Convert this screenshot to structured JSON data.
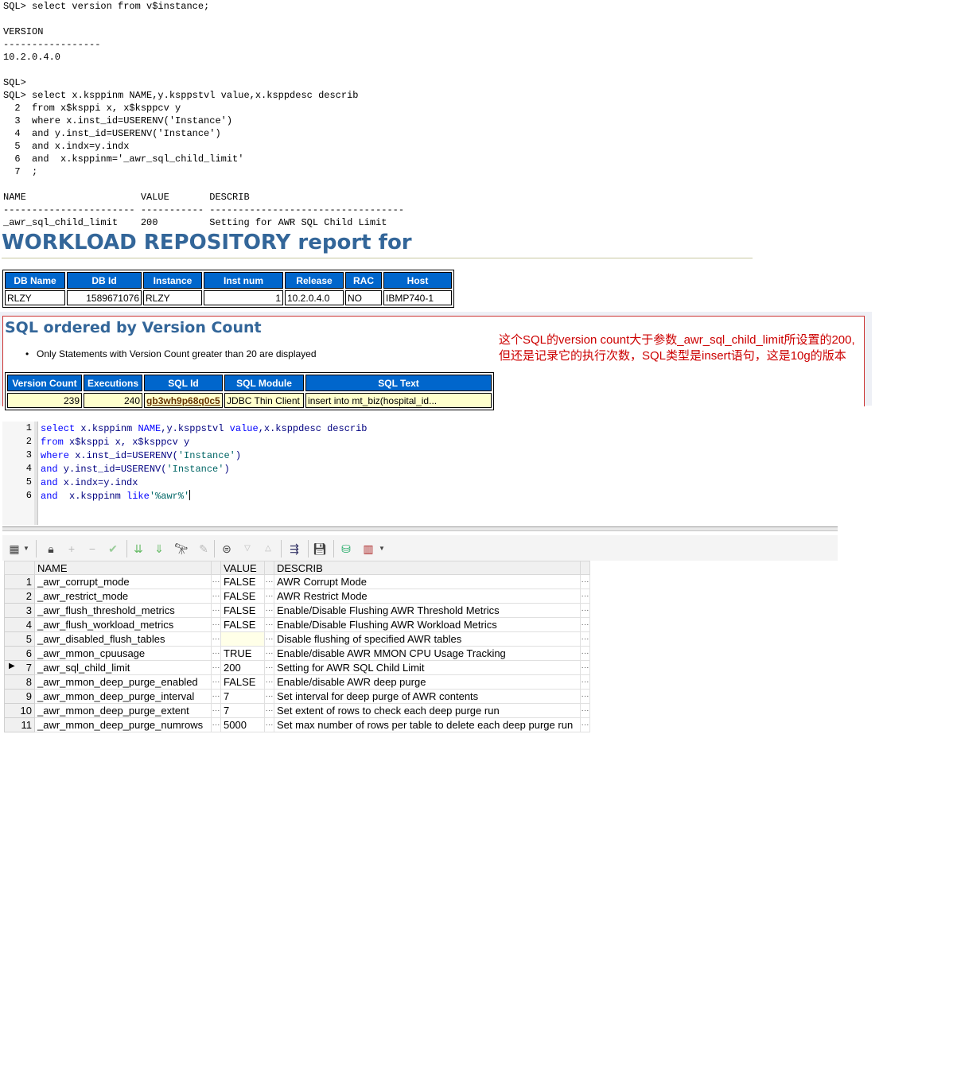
{
  "console": {
    "lines": [
      "SQL> select version from v$instance;",
      "",
      "VERSION",
      "-----------------",
      "10.2.0.4.0",
      "",
      "SQL>",
      "SQL> select x.ksppinm NAME,y.ksppstvl value,x.ksppdesc describ",
      "  2  from x$ksppi x, x$ksppcv y",
      "  3  where x.inst_id=USERENV('Instance')",
      "  4  and y.inst_id=USERENV('Instance')",
      "  5  and x.indx=y.indx",
      "  6  and  x.ksppinm='_awr_sql_child_limit'",
      "  7  ;",
      "",
      "NAME                    VALUE       DESCRIB",
      "----------------------- ----------- ----------------------------------",
      "_awr_sql_child_limit    200         Setting for AWR SQL Child Limit"
    ]
  },
  "awr": {
    "title": "WORKLOAD REPOSITORY report for",
    "db_table": {
      "headers": [
        "DB Name",
        "DB Id",
        "Instance",
        "Inst num",
        "Release",
        "RAC",
        "Host"
      ],
      "row": [
        "RLZY",
        "1589671076",
        "RLZY",
        "1",
        "10.2.0.4.0",
        "NO",
        "IBMP740-1"
      ]
    },
    "version_count": {
      "title": "SQL ordered by Version Count",
      "note": "Only Statements with Version Count greater than 20 are displayed",
      "headers": [
        "Version Count",
        "Executions",
        "SQL Id",
        "SQL Module",
        "SQL Text"
      ],
      "row": [
        "239",
        "240",
        "gb3wh9p68q0c5",
        "JDBC Thin Client",
        "insert into mt_biz(hospital_id..."
      ]
    },
    "annotation": "这个SQL的version count大于参数_awr_sql_child_limit所设置的200,但还是记录它的执行次数，SQL类型是insert语句，这是10g的版本"
  },
  "editor": {
    "lines": [
      {
        "num": "1",
        "parts": [
          [
            "kw",
            "select"
          ],
          [
            "plain",
            " x.ksppinm "
          ],
          [
            "kw",
            "NAME"
          ],
          [
            "plain",
            ",y.ksppstvl "
          ],
          [
            "kw",
            "value"
          ],
          [
            "plain",
            ",x.ksppdesc describ"
          ]
        ]
      },
      {
        "num": "2",
        "parts": [
          [
            "kw",
            "from"
          ],
          [
            "plain",
            " x$ksppi x, x$ksppcv y"
          ]
        ]
      },
      {
        "num": "3",
        "parts": [
          [
            "kw",
            "where"
          ],
          [
            "plain",
            " x.inst_id=USERENV("
          ],
          [
            "str",
            "'Instance'"
          ],
          [
            "plain",
            ")"
          ]
        ]
      },
      {
        "num": "4",
        "parts": [
          [
            "kw",
            "and"
          ],
          [
            "plain",
            " y.inst_id=USERENV("
          ],
          [
            "str",
            "'Instance'"
          ],
          [
            "plain",
            ")"
          ]
        ]
      },
      {
        "num": "5",
        "parts": [
          [
            "kw",
            "and"
          ],
          [
            "plain",
            " x.indx=y.indx"
          ]
        ]
      },
      {
        "num": "6",
        "parts": [
          [
            "kw",
            "and"
          ],
          [
            "plain",
            "  x.ksppinm "
          ],
          [
            "kw",
            "like"
          ],
          [
            "str",
            "'%awr%'"
          ]
        ]
      }
    ]
  },
  "toolbar": {
    "icons": [
      "grid-view-icon",
      "dropdown-arrow-icon",
      "lock-icon",
      "add-record-icon",
      "delete-record-icon",
      "post-changes-icon",
      "fetch-next-icon",
      "fetch-last-icon",
      "find-icon",
      "clear-icon",
      "query-by-example-icon",
      "sort-desc-icon",
      "sort-asc-icon",
      "export-icon",
      "save-icon",
      "connection-icon",
      "chart-icon",
      "chart-dropdown-icon"
    ]
  },
  "results": {
    "headers": [
      "NAME",
      "VALUE",
      "DESCRIB"
    ],
    "current_row": 7,
    "rows": [
      [
        "1",
        "_awr_corrupt_mode",
        "FALSE",
        "AWR Corrupt Mode"
      ],
      [
        "2",
        "_awr_restrict_mode",
        "FALSE",
        "AWR Restrict Mode"
      ],
      [
        "3",
        "_awr_flush_threshold_metrics",
        "FALSE",
        "Enable/Disable Flushing AWR Threshold Metrics"
      ],
      [
        "4",
        "_awr_flush_workload_metrics",
        "FALSE",
        "Enable/Disable Flushing AWR Workload Metrics"
      ],
      [
        "5",
        "_awr_disabled_flush_tables",
        "",
        "Disable flushing of specified AWR tables"
      ],
      [
        "6",
        "_awr_mmon_cpuusage",
        "TRUE",
        "Enable/disable AWR MMON CPU Usage Tracking"
      ],
      [
        "7",
        "_awr_sql_child_limit",
        "200",
        "Setting for AWR SQL Child Limit"
      ],
      [
        "8",
        "_awr_mmon_deep_purge_enabled",
        "FALSE",
        "Enable/disable AWR deep purge"
      ],
      [
        "9",
        "_awr_mmon_deep_purge_interval",
        "7",
        "Set interval for deep purge of AWR contents"
      ],
      [
        "10",
        "_awr_mmon_deep_purge_extent",
        "7",
        "Set extent of rows to check each deep purge run"
      ],
      [
        "11",
        "_awr_mmon_deep_purge_numrows",
        "5000",
        "Set max number of rows per table to delete each deep purge run"
      ]
    ]
  }
}
